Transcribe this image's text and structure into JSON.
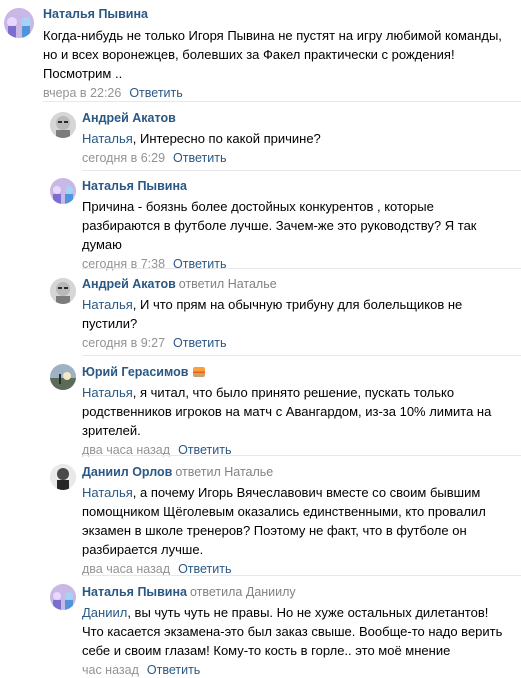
{
  "comments": [
    {
      "author": "Наталья Пывина",
      "reply_to": "",
      "text": "Когда-нибудь не только Игоря Пывина не пустят на игру любимой команды, но и всех воронежцев, болевших за Факел практически с рождения! Посмотрим ..",
      "time": "вчера в 22:26",
      "reply_label": "Ответить",
      "avatar": "girls-avatar"
    },
    {
      "author": "Андрей Акатов",
      "reply_to": "",
      "mention": "Наталья",
      "text": ", Интересно по какой причине?",
      "time": "сегодня в 6:29",
      "reply_label": "Ответить",
      "avatar": "man-glasses-avatar"
    },
    {
      "author": "Наталья Пывина",
      "reply_to": "",
      "text": "Причина - боязнь более достойных конкурентов , которые разбираются в футболе лучше. Зачем-же это руководству? Я так думаю",
      "time": "сегодня в 7:38",
      "reply_label": "Ответить",
      "avatar": "girls-avatar"
    },
    {
      "author": "Андрей Акатов",
      "reply_to": "ответил Наталье",
      "mention": "Наталья",
      "text": ", И что прям на обычную трибуну для болельщиков не пустили?",
      "time": "сегодня в 9:27",
      "reply_label": "Ответить",
      "avatar": "man-glasses-avatar"
    },
    {
      "author": "Юрий Герасимов",
      "reply_to": "",
      "mention": "Наталья",
      "text": ", я читал, что было принято решение, пускать только родственников игроков на матч с Авангардом, из-за 10% лимита на зрителей.",
      "time": "два часа назад",
      "reply_label": "Ответить",
      "avatar": "sunset-avatar",
      "emoji": "sunset-emoji"
    },
    {
      "author": "Даниил Орлов",
      "reply_to": "ответил Наталье",
      "mention": "Наталья",
      "text": ", а почему Игорь Вячеславович вместе со своим бывшим помощником Щёголевым оказались единственными, кто провалил экзамен в школе тренеров? Поэтому не факт, что в футболе он разбирается лучше.",
      "time": "два часа назад",
      "reply_label": "Ответить",
      "avatar": "man-bw-avatar"
    },
    {
      "author": "Наталья Пывина",
      "reply_to": "ответила Даниилу",
      "mention": "Даниил",
      "text": ", вы чуть чуть не правы. Но не хуже остальных дилетантов! Что касается экзамена-это был заказ свыше. Вообще-то надо верить себе и своим глазам! Кому-то кость в горле.. это моё мнение",
      "time": "час назад",
      "reply_label": "Ответить",
      "avatar": "girls-avatar"
    }
  ],
  "colors": {
    "link": "#2a5885",
    "meta": "#939393",
    "divider": "#e7e8ec"
  }
}
